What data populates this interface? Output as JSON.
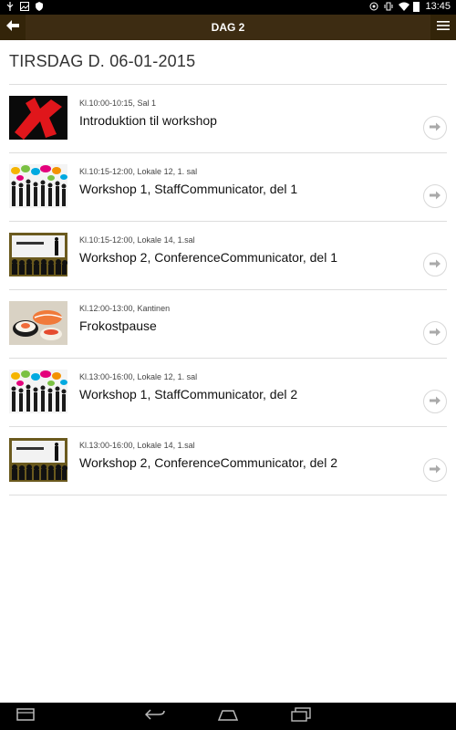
{
  "status_bar": {
    "time": "13:45",
    "left_icons": [
      "usb-icon",
      "image-icon",
      "shield-icon"
    ],
    "right_icons": [
      "headset-icon",
      "vibrate-icon",
      "wifi-icon",
      "battery-icon"
    ]
  },
  "header": {
    "title": "DAG 2",
    "back_icon": "arrow-left-icon",
    "menu_icon": "hamburger-icon"
  },
  "page": {
    "title": "TIRSDAG D. 06-01-2015"
  },
  "sessions": [
    {
      "time": "Kl.10:00-10:15, Sal 1",
      "name": "Introduktion til workshop",
      "thumb": "red-logo"
    },
    {
      "time": "Kl.10:15-12:00, Lokale 12, 1. sal",
      "name": "Workshop 1, StaffCommunicator, del 1",
      "thumb": "speech-bubbles"
    },
    {
      "time": "Kl.10:15-12:00, Lokale 14, 1.sal",
      "name": "Workshop 2, ConferenceCommunicator, del 1",
      "thumb": "conference"
    },
    {
      "time": "Kl.12:00-13:00, Kantinen",
      "name": "Frokostpause",
      "thumb": "sushi"
    },
    {
      "time": "Kl.13:00-16:00, Lokale 12, 1. sal",
      "name": "Workshop 1, StaffCommunicator, del 2",
      "thumb": "speech-bubbles"
    },
    {
      "time": "Kl.13:00-16:00, Lokale 14, 1.sal",
      "name": "Workshop 2, ConferenceCommunicator, del 2",
      "thumb": "conference"
    }
  ],
  "nav_bar": {
    "icons": [
      "recents-window-icon",
      "back-icon",
      "home-icon",
      "recent-apps-icon"
    ]
  },
  "colors": {
    "header_bg": "#3d2c12",
    "status_bg": "#000000",
    "divider": "#dddddd"
  }
}
